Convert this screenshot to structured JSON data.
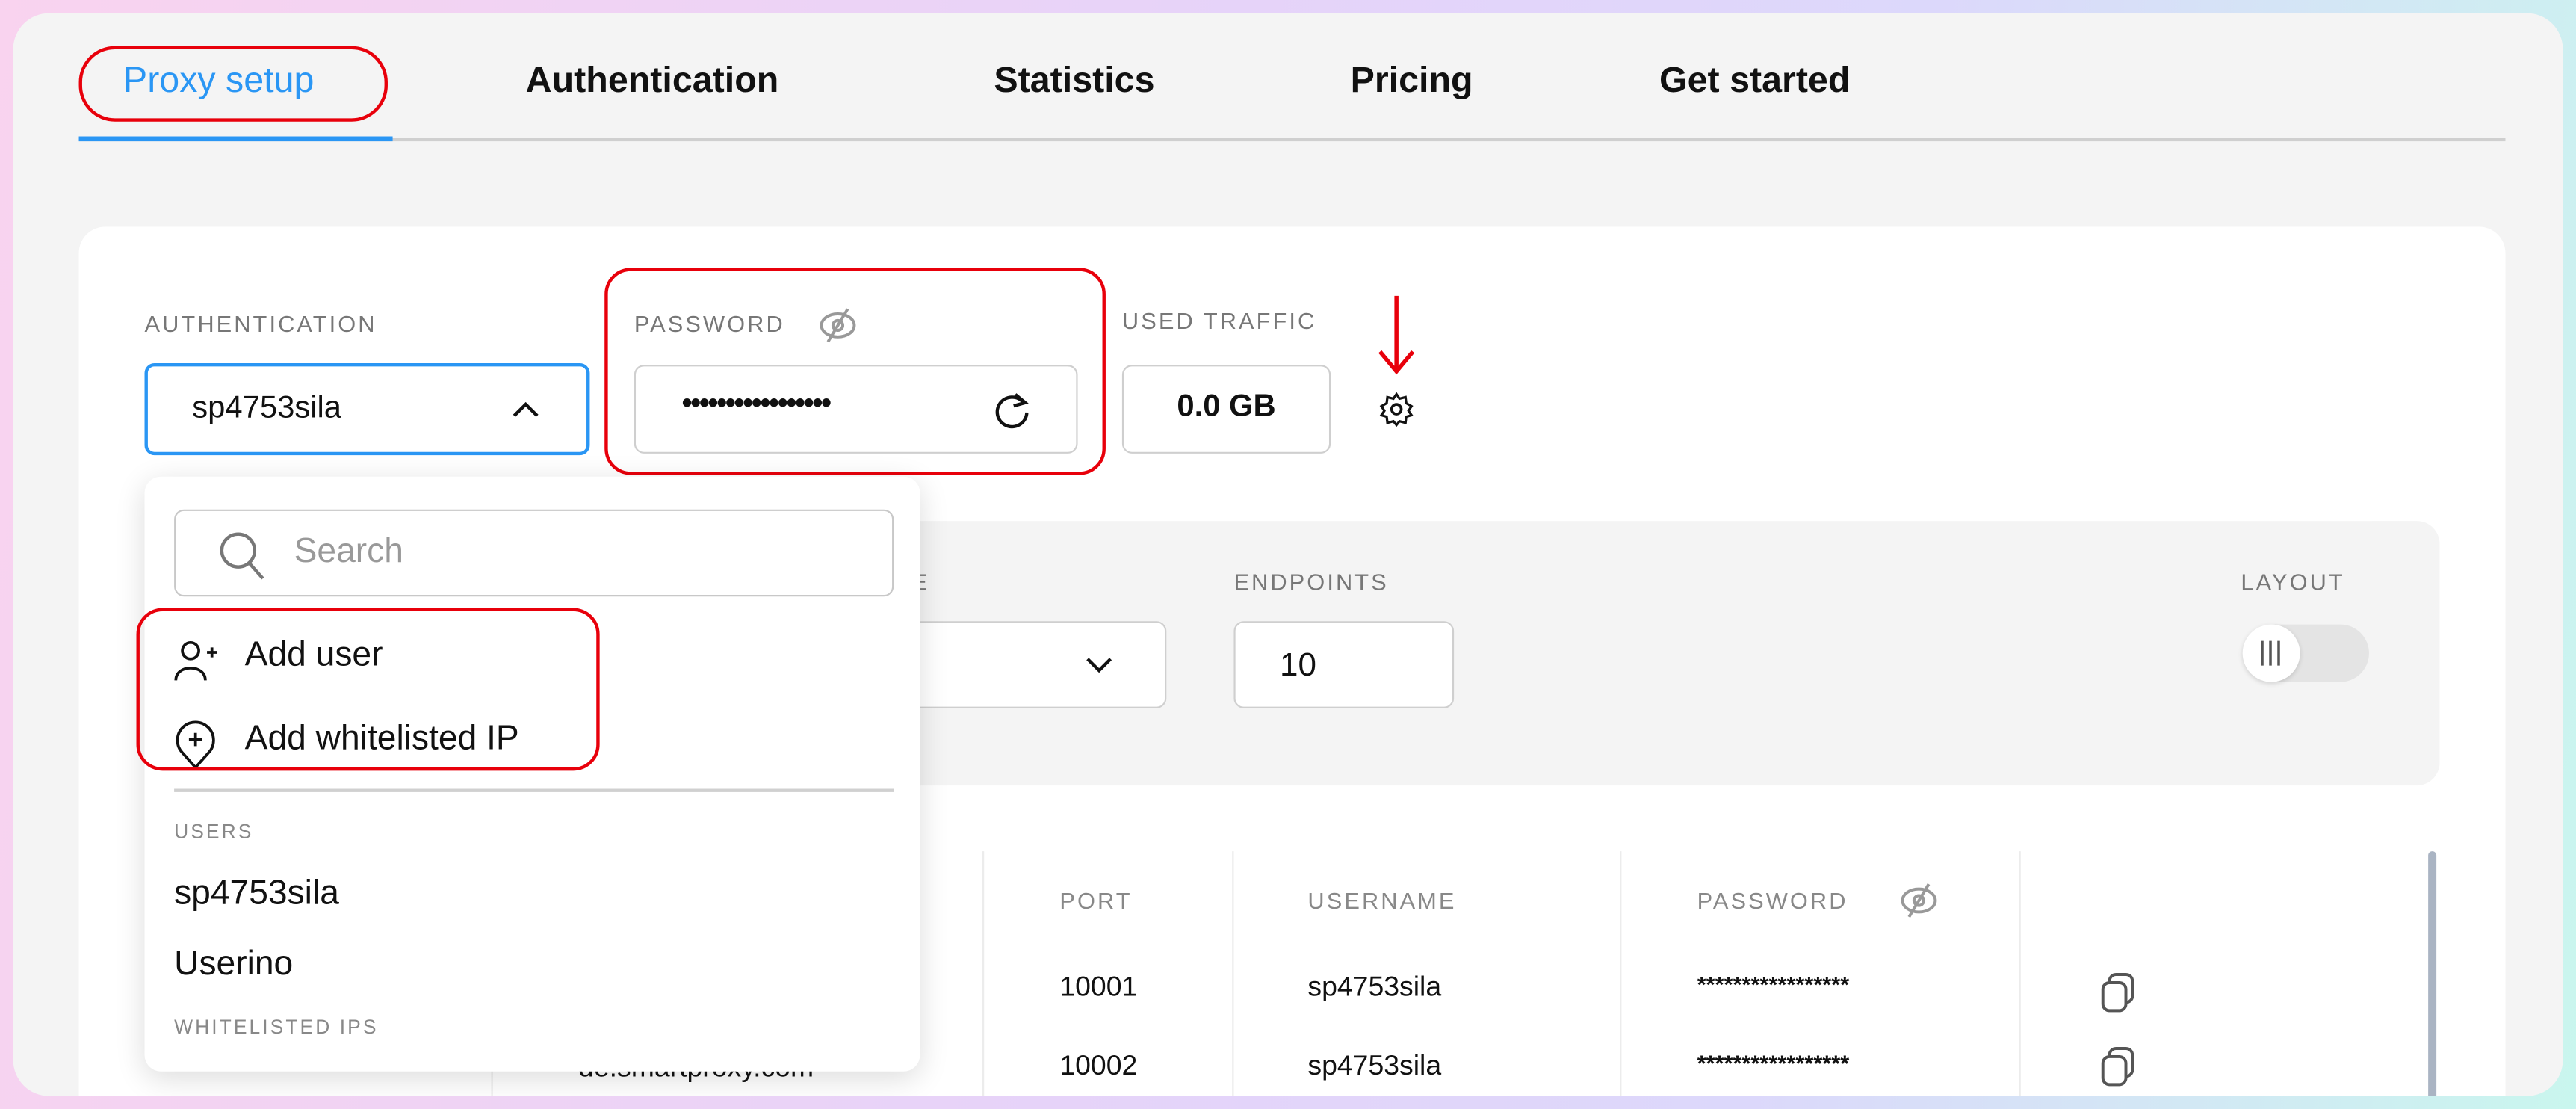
{
  "tabs": [
    {
      "label": "Proxy setup",
      "active": true
    },
    {
      "label": "Authentication",
      "active": false
    },
    {
      "label": "Statistics",
      "active": false
    },
    {
      "label": "Pricing",
      "active": false
    },
    {
      "label": "Get started",
      "active": false
    }
  ],
  "accent_color": "#2a96f4",
  "highlight_color": "#e8000b",
  "authentication": {
    "label": "AUTHENTICATION",
    "value": "sp4753sila"
  },
  "password": {
    "label": "PASSWORD",
    "value": "•••••••••••••••••"
  },
  "used_traffic": {
    "label": "USED TRAFFIC",
    "value": "0.0 GB"
  },
  "settings": {
    "partial_label": "E",
    "endpoints_label": "ENDPOINTS",
    "endpoints_value": "10",
    "layout_label": "LAYOUT"
  },
  "table": {
    "headers": {
      "port": "PORT",
      "username": "USERNAME",
      "password": "PASSWORD"
    },
    "rows": [
      {
        "host": "",
        "port": "10001",
        "username": "sp4753sila",
        "password": "*****************"
      },
      {
        "host": "de.smartproxy.com",
        "port": "10002",
        "username": "sp4753sila",
        "password": "*****************"
      }
    ]
  },
  "dropdown": {
    "search_placeholder": "Search",
    "add_user": "Add user",
    "add_whitelisted_ip": "Add whitelisted IP",
    "users_heading": "USERS",
    "users": [
      "sp4753sila",
      "Userino"
    ],
    "whitelisted_heading": "WHITELISTED IPS"
  }
}
